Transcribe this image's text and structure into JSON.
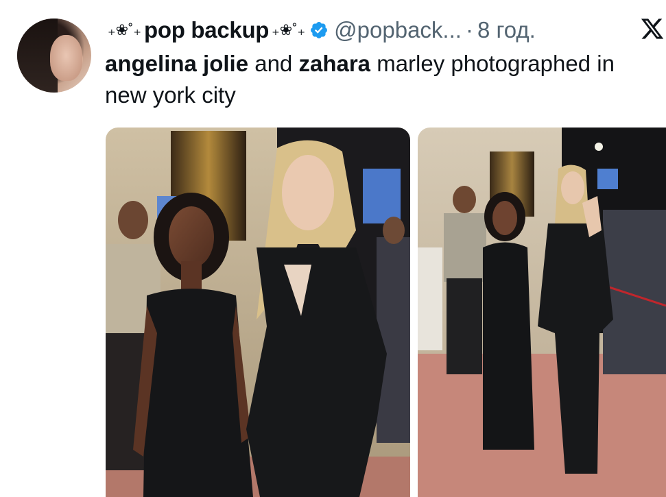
{
  "tweet": {
    "display_name": "pop backup",
    "name_decoration": "₊❀˚₊",
    "handle": "@popback...",
    "separator": "·",
    "time": "8 год.",
    "text_parts": [
      {
        "text": "angelina jolie",
        "bold": true
      },
      {
        "text": " and ",
        "bold": false
      },
      {
        "text": "zahara",
        "bold": true
      },
      {
        "text": " marley photographed in new york city",
        "bold": false
      }
    ]
  },
  "icons": {
    "avatar": "profile-avatar",
    "verified": "verified-badge-icon",
    "brand": "x-logo-icon"
  },
  "colors": {
    "verified": "#1d9bf0",
    "secondary_text": "#536471",
    "primary_text": "#0f1419"
  },
  "media": [
    {
      "name": "photo-left"
    },
    {
      "name": "photo-right"
    }
  ]
}
